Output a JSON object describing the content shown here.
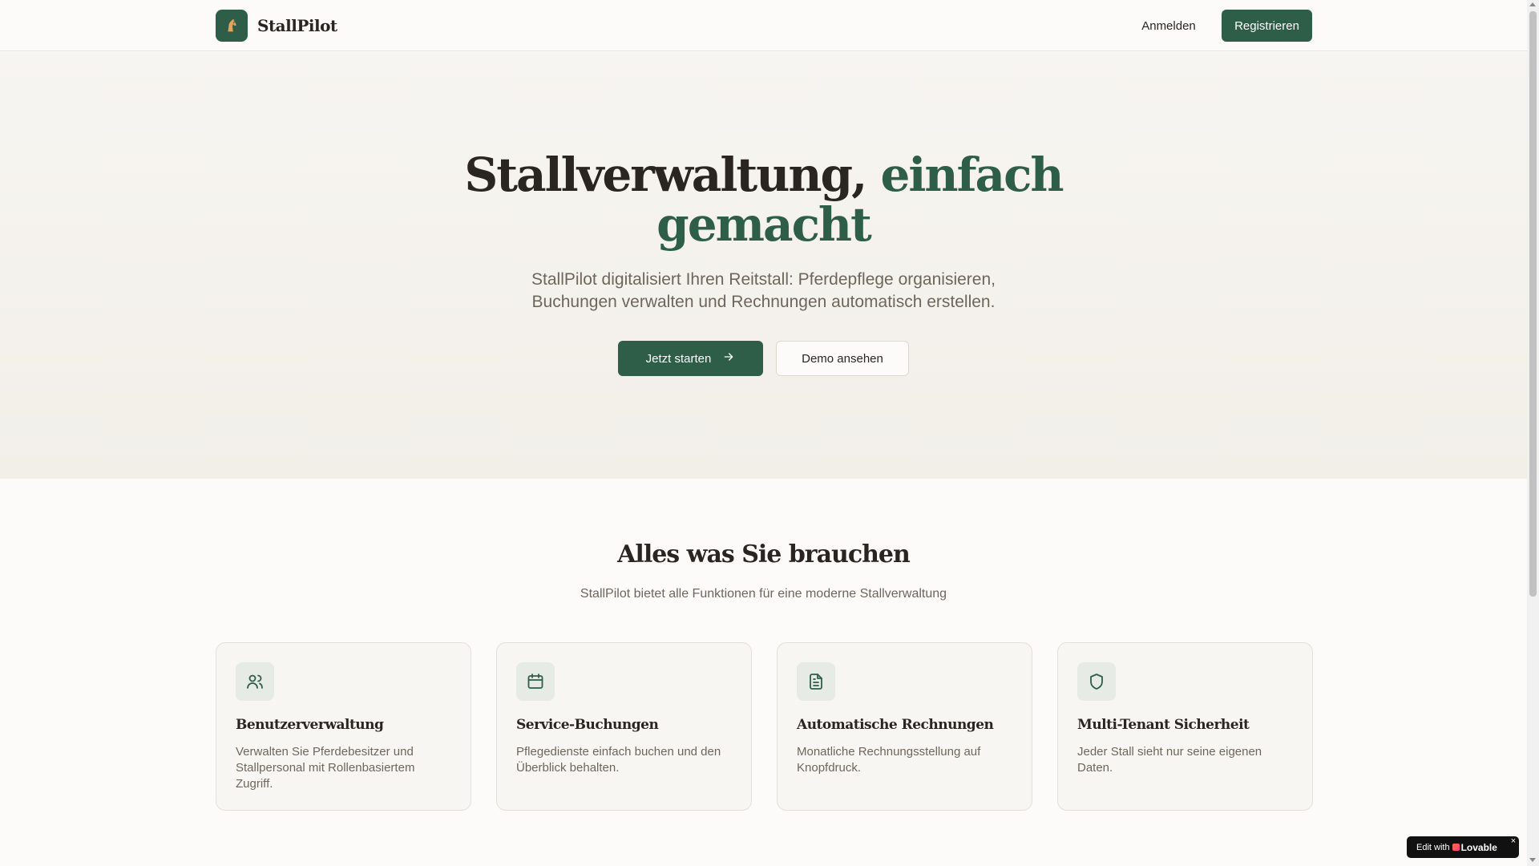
{
  "header": {
    "brand_name": "StallPilot",
    "login_label": "Anmelden",
    "register_label": "Registrieren"
  },
  "hero": {
    "title_main": "Stallverwaltung,",
    "title_accent_1": "einfach",
    "title_accent_2": "gemacht",
    "subtitle_line1": "StallPilot digitalisiert Ihren Reitstall: Pferdepflege organisieren,",
    "subtitle_line2": "Buchungen verwalten und Rechnungen automatisch erstellen.",
    "primary_cta": "Jetzt starten",
    "secondary_cta": "Demo ansehen"
  },
  "features": {
    "title": "Alles was Sie brauchen",
    "subtitle": "StallPilot bietet alle Funktionen für eine moderne Stallverwaltung",
    "cards": [
      {
        "icon": "users-icon",
        "title": "Benutzerverwaltung",
        "description": "Verwalten Sie Pferdebesitzer und Stallpersonal mit Rollenbasiertem Zugriff."
      },
      {
        "icon": "calendar-icon",
        "title": "Service-Buchungen",
        "description": "Pflegedienste einfach buchen und den Überblick behalten."
      },
      {
        "icon": "document-icon",
        "title": "Automatische Rechnungen",
        "description": "Monatliche Rechnungsstellung auf Knopfdruck."
      },
      {
        "icon": "shield-icon",
        "title": "Multi-Tenant Sicherheit",
        "description": "Jeder Stall sieht nur seine eigenen Daten."
      }
    ]
  },
  "badge": {
    "prefix": "Edit with",
    "brand": "Lovable",
    "close": "×"
  },
  "colors": {
    "primary": "#2e5e48",
    "text": "#2a2520",
    "muted": "#6e665c",
    "background": "#fcfbf9"
  }
}
